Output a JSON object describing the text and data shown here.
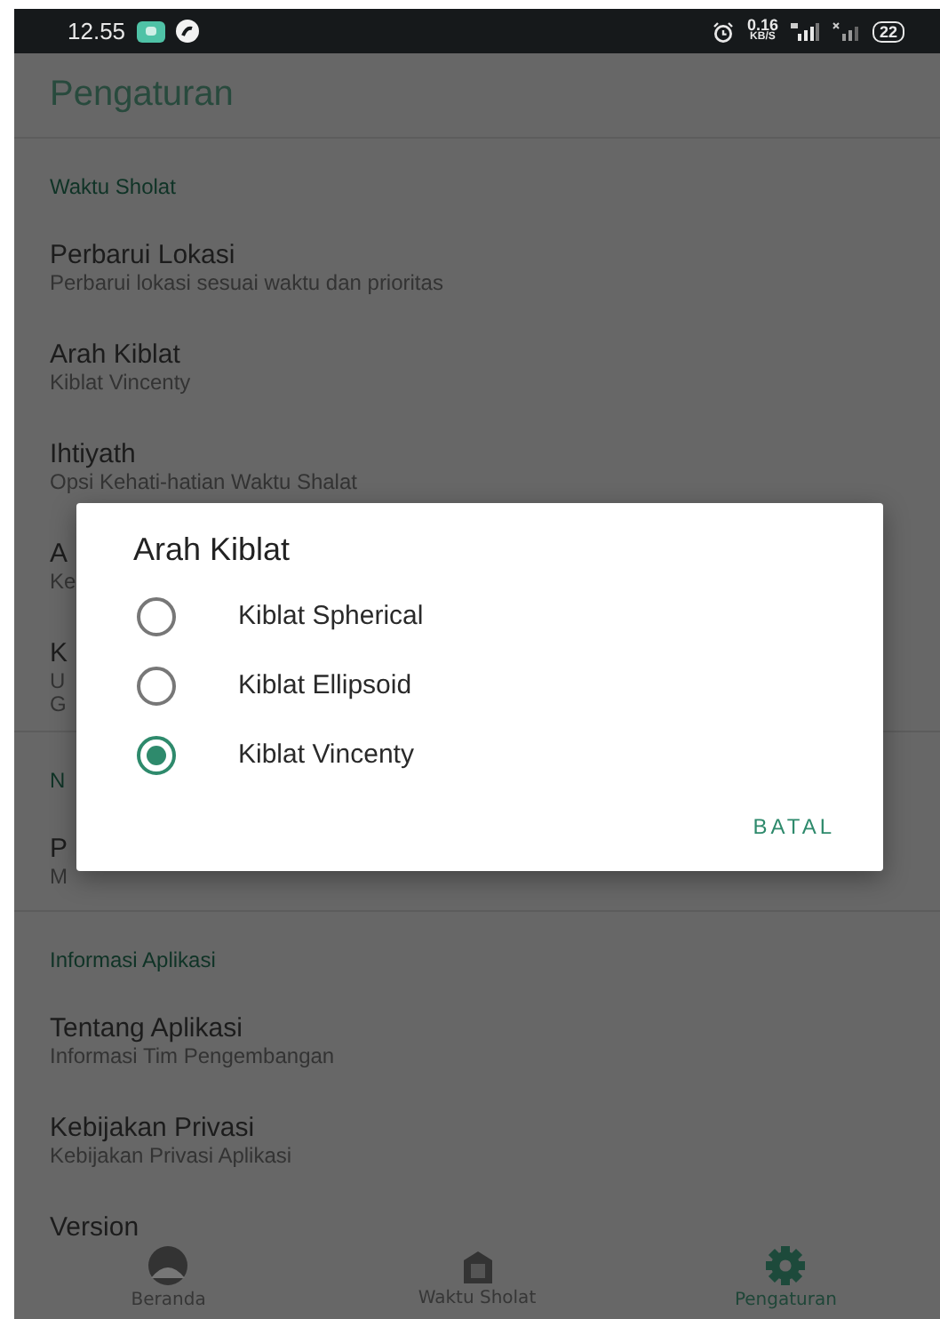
{
  "status_bar": {
    "time": "12.55",
    "net_speed": "0.16",
    "net_unit": "KB/S",
    "battery": "22"
  },
  "app_bar": {
    "title": "Pengaturan"
  },
  "sections": [
    {
      "title": "Waktu Sholat",
      "items": [
        {
          "title": "Perbarui Lokasi",
          "subtitle": [
            "Perbarui lokasi sesuai waktu dan prioritas"
          ]
        },
        {
          "title": "Arah Kiblat",
          "subtitle": [
            "Kiblat Vincenty"
          ]
        },
        {
          "title": "Ihtiyath",
          "subtitle": [
            "Opsi Kehati-hatian Waktu Shalat"
          ]
        },
        {
          "title": "A",
          "subtitle": [
            "Ke"
          ]
        },
        {
          "title": "K",
          "subtitle": [
            "U",
            "G"
          ]
        }
      ]
    },
    {
      "title": "N",
      "items": [
        {
          "title": "P",
          "subtitle": [
            "M"
          ]
        }
      ]
    },
    {
      "title": "Informasi Aplikasi",
      "items": [
        {
          "title": "Tentang Aplikasi",
          "subtitle": [
            "Informasi Tim Pengembangan"
          ]
        },
        {
          "title": "Kebijakan Privasi",
          "subtitle": [
            "Kebijakan Privasi Aplikasi"
          ]
        },
        {
          "title": "Version"
        }
      ]
    }
  ],
  "dialog": {
    "title": "Arah Kiblat",
    "options": [
      {
        "label": "Kiblat Spherical",
        "selected": false
      },
      {
        "label": "Kiblat Ellipsoid",
        "selected": false
      },
      {
        "label": "Kiblat Vincenty",
        "selected": true
      }
    ],
    "buttons": [
      "BATAL"
    ]
  },
  "bottom_nav": [
    {
      "label": "Beranda",
      "selected": false
    },
    {
      "label": "Waktu Sholat",
      "selected": false
    },
    {
      "label": "Pengaturan",
      "selected": true
    }
  ]
}
